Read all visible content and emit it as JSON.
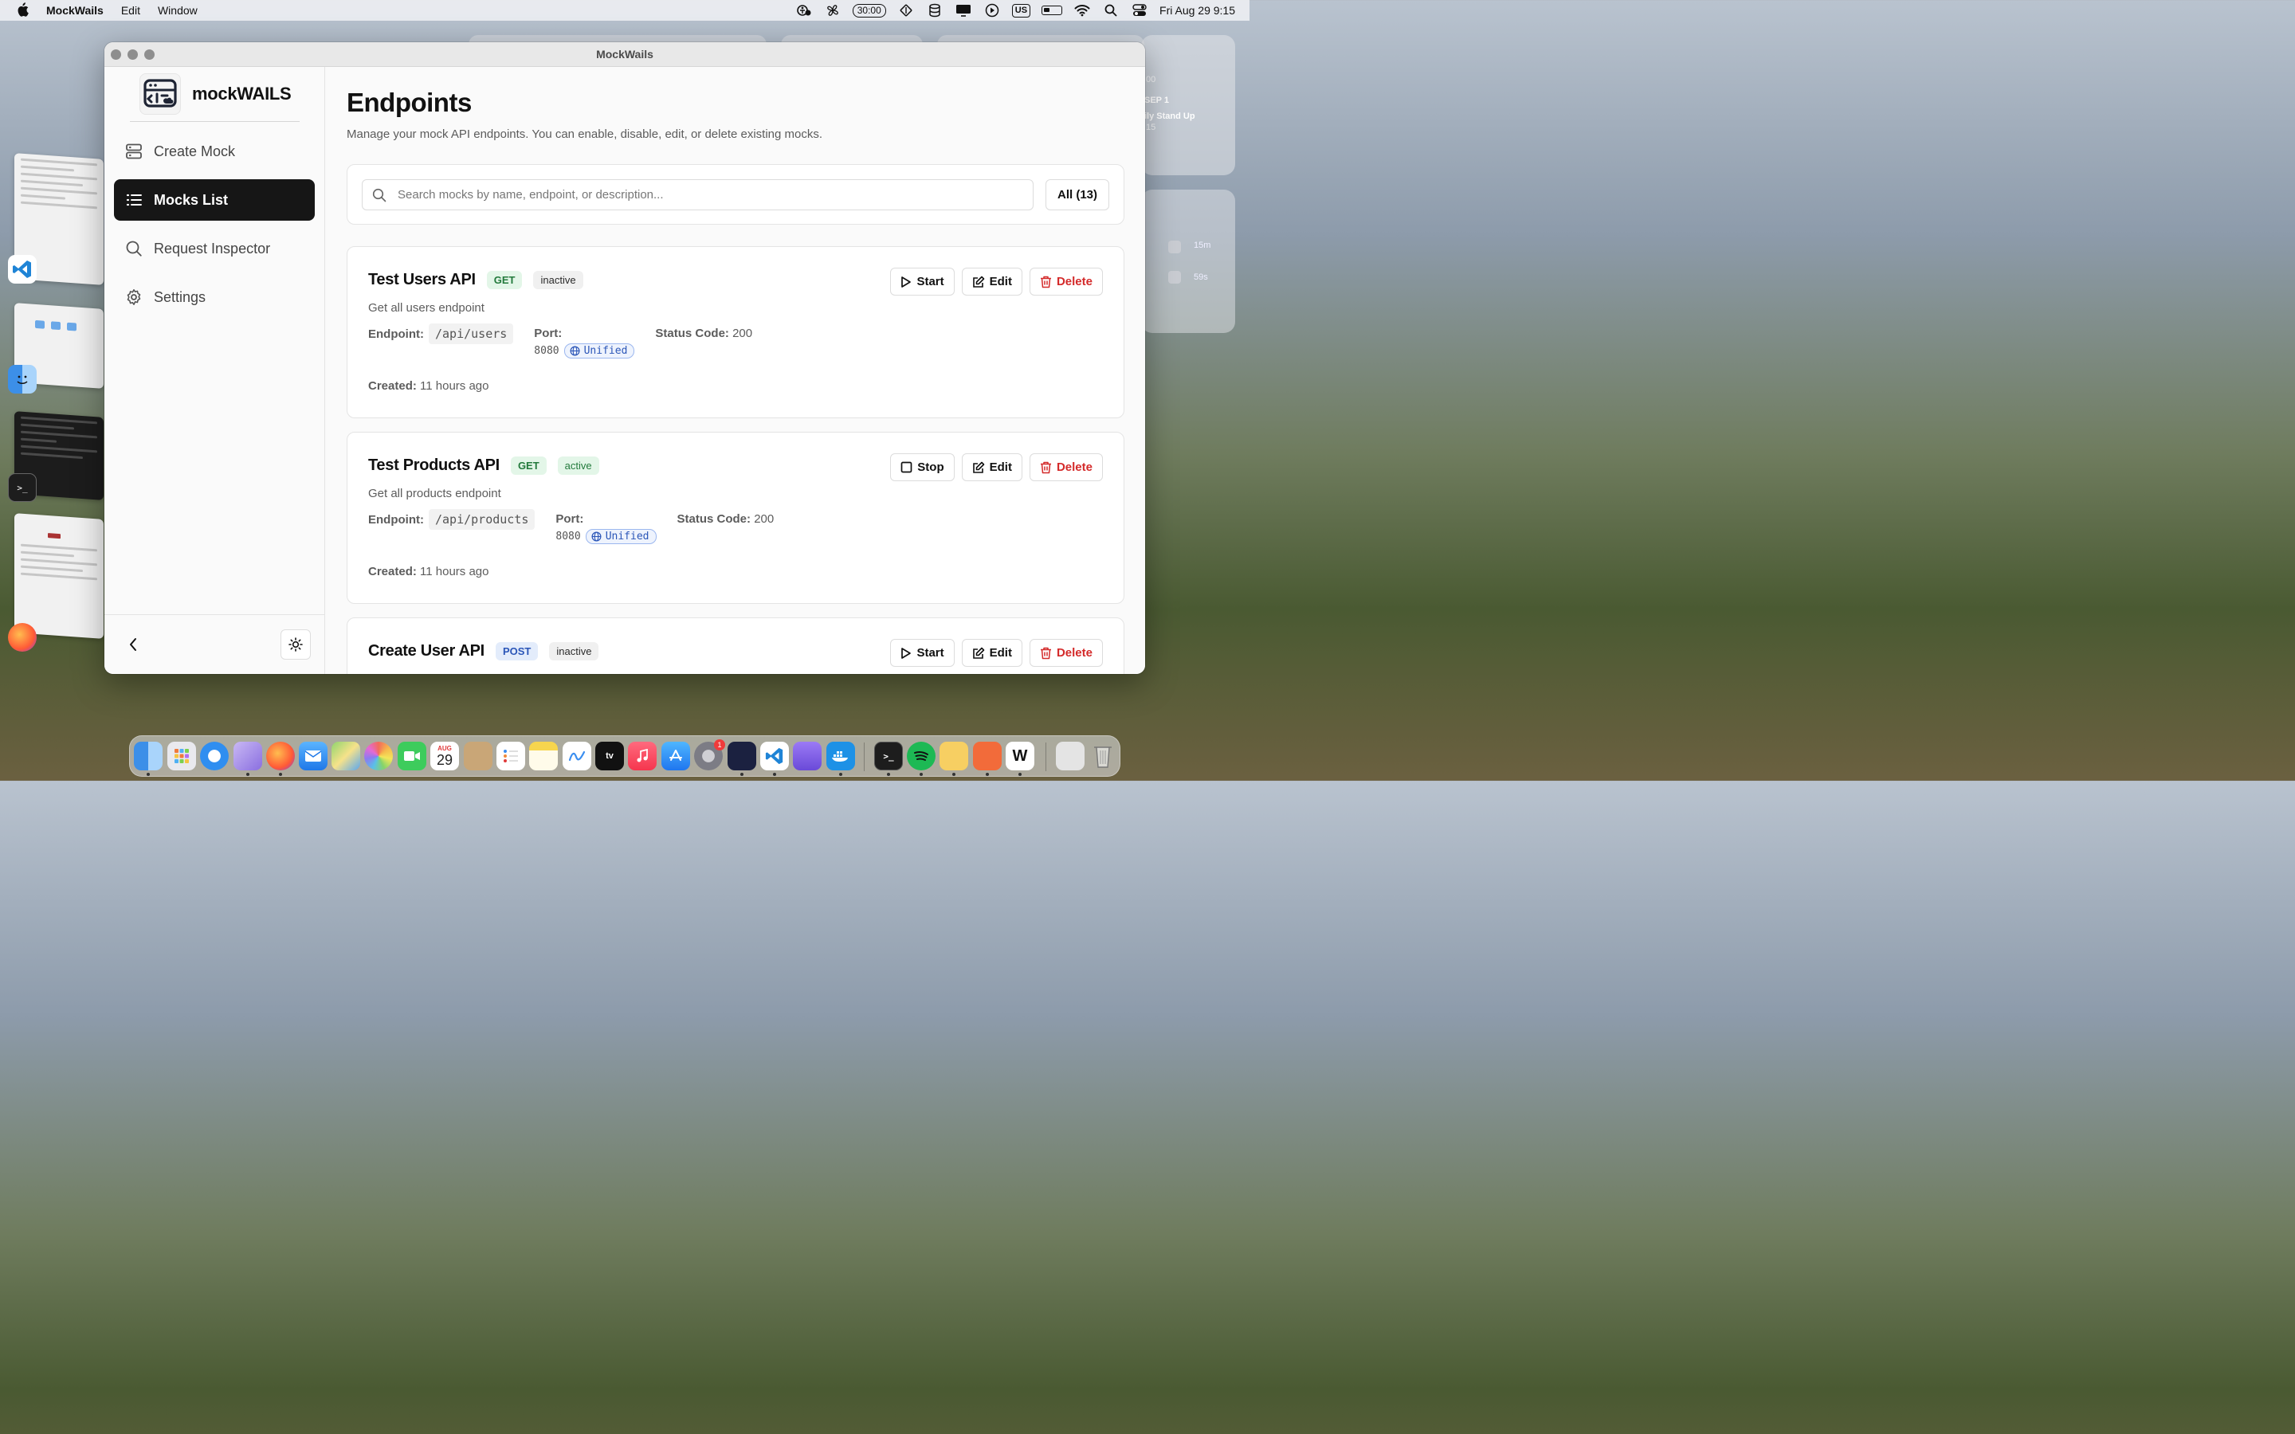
{
  "menubar": {
    "app_name": "MockWails",
    "menus": [
      "Edit",
      "Window"
    ],
    "timer": "30:00",
    "input_source": "US",
    "datetime": "Fri Aug 29  9:15"
  },
  "window": {
    "title": "MockWails"
  },
  "sidebar": {
    "brand": "mockWAILS",
    "items": [
      {
        "label": "Create Mock",
        "icon": "server-icon",
        "active": false
      },
      {
        "label": "Mocks List",
        "icon": "list-icon",
        "active": true
      },
      {
        "label": "Request Inspector",
        "icon": "search-icon",
        "active": false
      },
      {
        "label": "Settings",
        "icon": "gear-icon",
        "active": false
      }
    ]
  },
  "page": {
    "title": "Endpoints",
    "subtitle": "Manage your mock API endpoints. You can enable, disable, edit, or delete existing mocks."
  },
  "search": {
    "placeholder": "Search mocks by name, endpoint, or description...",
    "value": "",
    "filter_label": "All (13)"
  },
  "labels": {
    "endpoint": "Endpoint:",
    "port": "Port:",
    "status_code": "Status Code:",
    "created": "Created:",
    "unified": "Unified",
    "start": "Start",
    "stop": "Stop",
    "edit": "Edit",
    "delete": "Delete"
  },
  "mocks": [
    {
      "name": "Test Users API",
      "method": "GET",
      "status": "inactive",
      "description": "Get all users endpoint",
      "endpoint": "/api/users",
      "port": "8080",
      "status_code": "200",
      "created": "11 hours ago",
      "toggle": "Start"
    },
    {
      "name": "Test Products API",
      "method": "GET",
      "status": "active",
      "description": "Get all products endpoint",
      "endpoint": "/api/products",
      "port": "8080",
      "status_code": "200",
      "created": "11 hours ago",
      "toggle": "Stop"
    },
    {
      "name": "Create User API",
      "method": "POST",
      "status": "inactive",
      "toggle": "Start"
    }
  ],
  "background": {
    "calendar_header": "SEP 1",
    "calendar_event": "ily Stand Up",
    "calendar_time": "15",
    "calendar_top": "00",
    "notif_times": [
      "15m",
      "59s"
    ]
  },
  "dock": {
    "calendar_month": "AUG",
    "calendar_day": "29",
    "settings_badge": "1"
  },
  "colors": {
    "accent_dark": "#161616",
    "get_badge": "#237a3c",
    "post_badge": "#2b56b8",
    "danger": "#d42a2a"
  }
}
